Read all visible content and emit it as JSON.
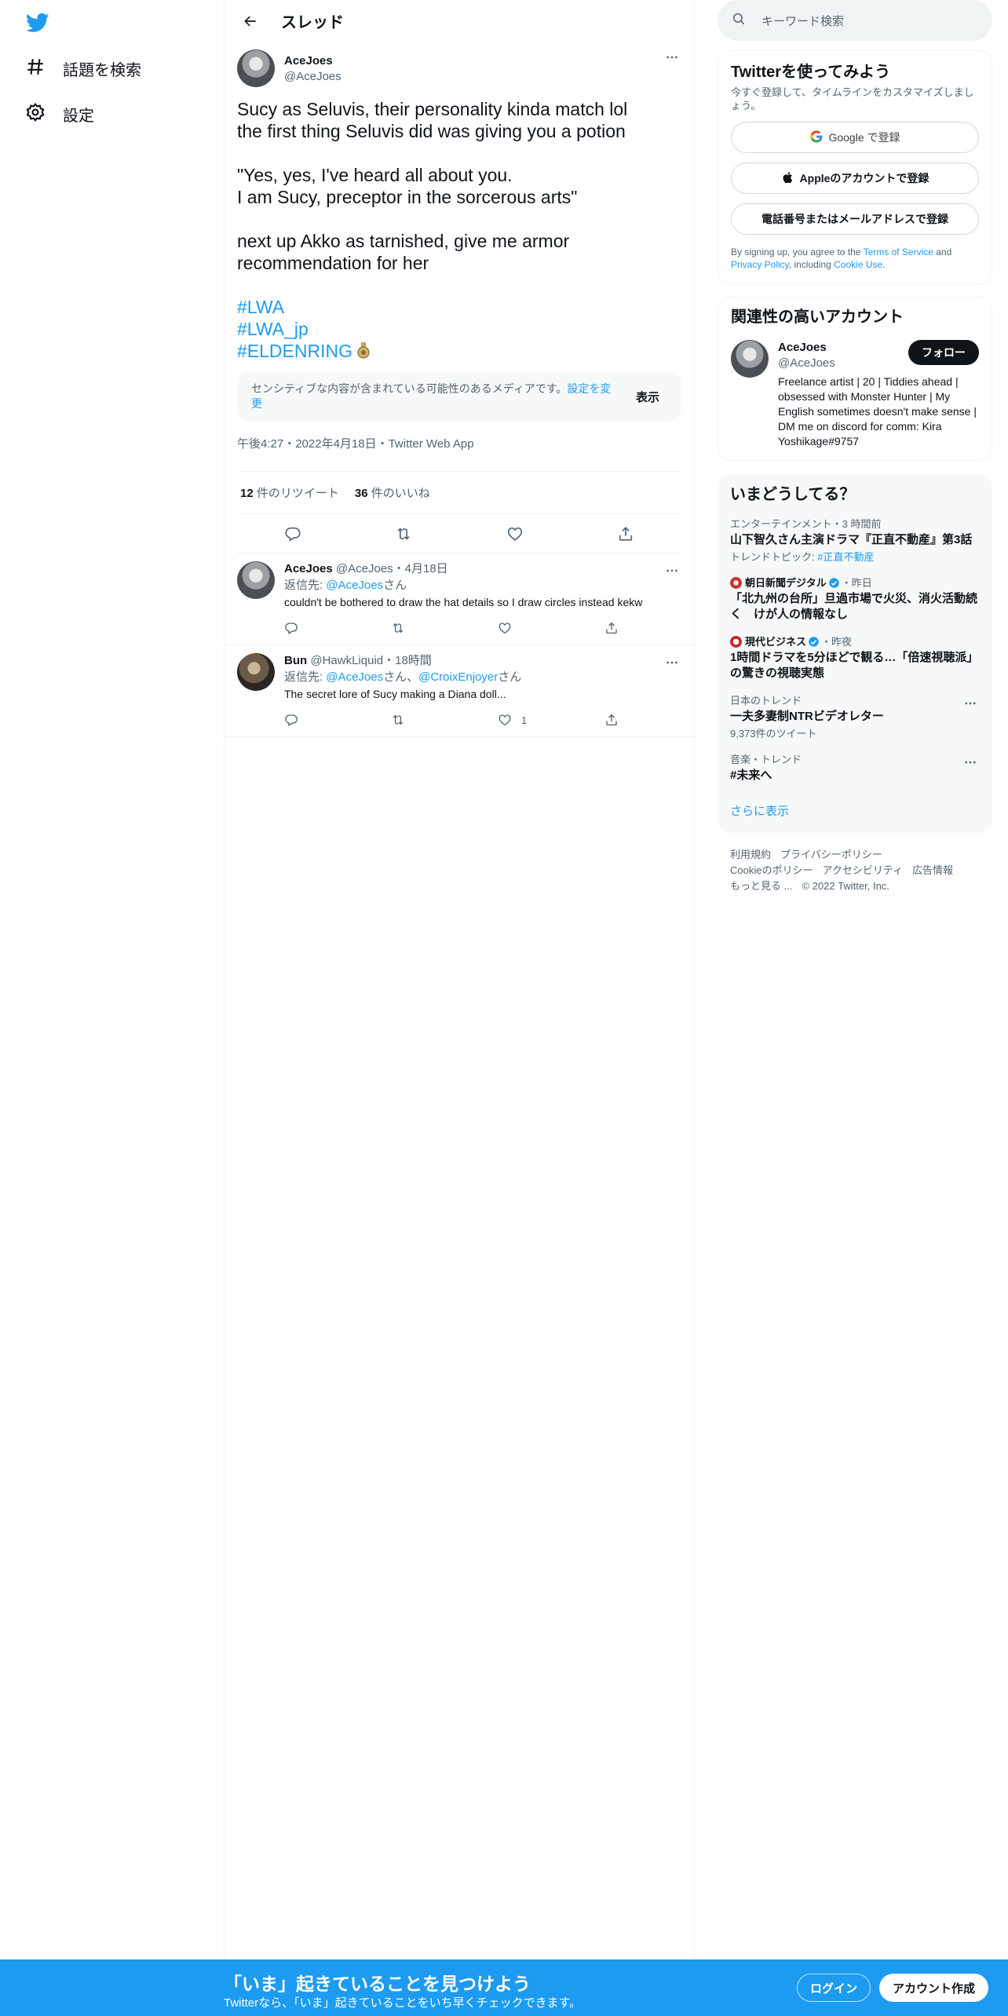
{
  "nav": {
    "items": [
      {
        "label": "話題を検索",
        "icon": "hashtag-icon"
      },
      {
        "label": "設定",
        "icon": "gear-icon"
      }
    ]
  },
  "header": {
    "title": "スレッド"
  },
  "tweet": {
    "name": "AceJoes",
    "handle": "@AceJoes",
    "lines": [
      "Sucy as Seluvis, their personality kinda match lol",
      "the first thing Seluvis did was giving you a potion",
      "",
      "\"Yes, yes, I've heard all about you.",
      "I am Sucy, preceptor in the sorcerous arts\"",
      "",
      "next up Akko as tarnished, give me armor",
      "recommendation for her",
      ""
    ],
    "hashtags": [
      "#LWA",
      "#LWA_jp",
      "#ELDENRING"
    ],
    "sensitive_msg": "センシティブな内容が含まれている可能性のあるメディアです。",
    "sensitive_link": "設定を変更",
    "show_label": "表示",
    "meta": "午後4:27・2022年4月18日・Twitter Web App",
    "retweets": "12",
    "retweets_label": "件のリツイート",
    "likes": "36",
    "likes_label": "件のいいね"
  },
  "replies": [
    {
      "name": "AceJoes",
      "handle": "@AceJoes",
      "time": "・4月18日",
      "reply_to_prefix": "返信先: ",
      "reply_to": [
        "@AceJoes"
      ],
      "reply_to_suffix": "さん",
      "text": "couldn't be bothered to draw the hat details so I draw circles instead kekw",
      "likes": ""
    },
    {
      "name": "Bun",
      "handle": "@HawkLiquid",
      "time": "・18時間",
      "reply_to_prefix": "返信先: ",
      "reply_to": [
        "@AceJoes",
        "@CroixEnjoyer"
      ],
      "reply_to_mid": "さん、",
      "reply_to_suffix": "さん",
      "text": "The secret lore of Sucy making a Diana doll...",
      "likes": "1"
    }
  ],
  "search": {
    "placeholder": "キーワード検索"
  },
  "signup": {
    "title": "Twitterを使ってみよう",
    "subtitle": "今すぐ登録して、タイムラインをカスタマイズしましょう。",
    "google": "Google で登録",
    "apple": "Appleのアカウントで登録",
    "phone": "電話番号またはメールアドレスで登録",
    "legal_1": "By signing up, you agree to the ",
    "tos": "Terms of Service",
    "legal_2": " and ",
    "privacy": "Privacy Policy",
    "legal_3": ", including ",
    "cookie": "Cookie Use",
    "legal_4": "."
  },
  "related": {
    "title": "関連性の高いアカウント",
    "name": "AceJoes",
    "handle": "@AceJoes",
    "follow": "フォロー",
    "bio": "Freelance artist | 20 | Tiddies ahead | obsessed with Monster Hunter | My English sometimes doesn't make sense | DM me on discord for comm: Kira Yoshikage#9757"
  },
  "trends": {
    "title": "いまどうしてる？",
    "items": [
      {
        "context": "エンターテインメント・3 時間前",
        "title": "山下智久さん主演ドラマ『正直不動産』第3話",
        "sub_prefix": "トレンドトピック: ",
        "sub_link": "#正直不動産"
      },
      {
        "source": "朝日新聞デジタル",
        "ago": "・昨日",
        "title": "「北九州の台所」旦過市場で火災、消火活動続く　けが人の情報なし"
      },
      {
        "source": "現代ビジネス",
        "ago": "・昨夜",
        "title": "1時間ドラマを5分ほどで観る…「倍速視聴派」の驚きの視聴実態"
      },
      {
        "context": "日本のトレンド",
        "title": "一夫多妻制NTRビデオレター",
        "sub": "9,373件のツイート"
      },
      {
        "context": "音楽・トレンド",
        "title": "#未来へ"
      }
    ],
    "show_more": "さらに表示"
  },
  "footer": {
    "links": [
      "利用規約",
      "プライバシーポリシー",
      "Cookieのポリシー",
      "アクセシビリティ",
      "広告情報",
      "もっと見る ...",
      "© 2022 Twitter, Inc."
    ]
  },
  "bottom": {
    "title": "「いま」起きていることを見つけよう",
    "subtitle": "Twitterなら、「いま」起きていることをいち早くチェックできます。",
    "login": "ログイン",
    "signup": "アカウント作成"
  },
  "colors": {
    "accent": "#1d9bf0",
    "text": "#0f1419",
    "muted": "#536471"
  }
}
